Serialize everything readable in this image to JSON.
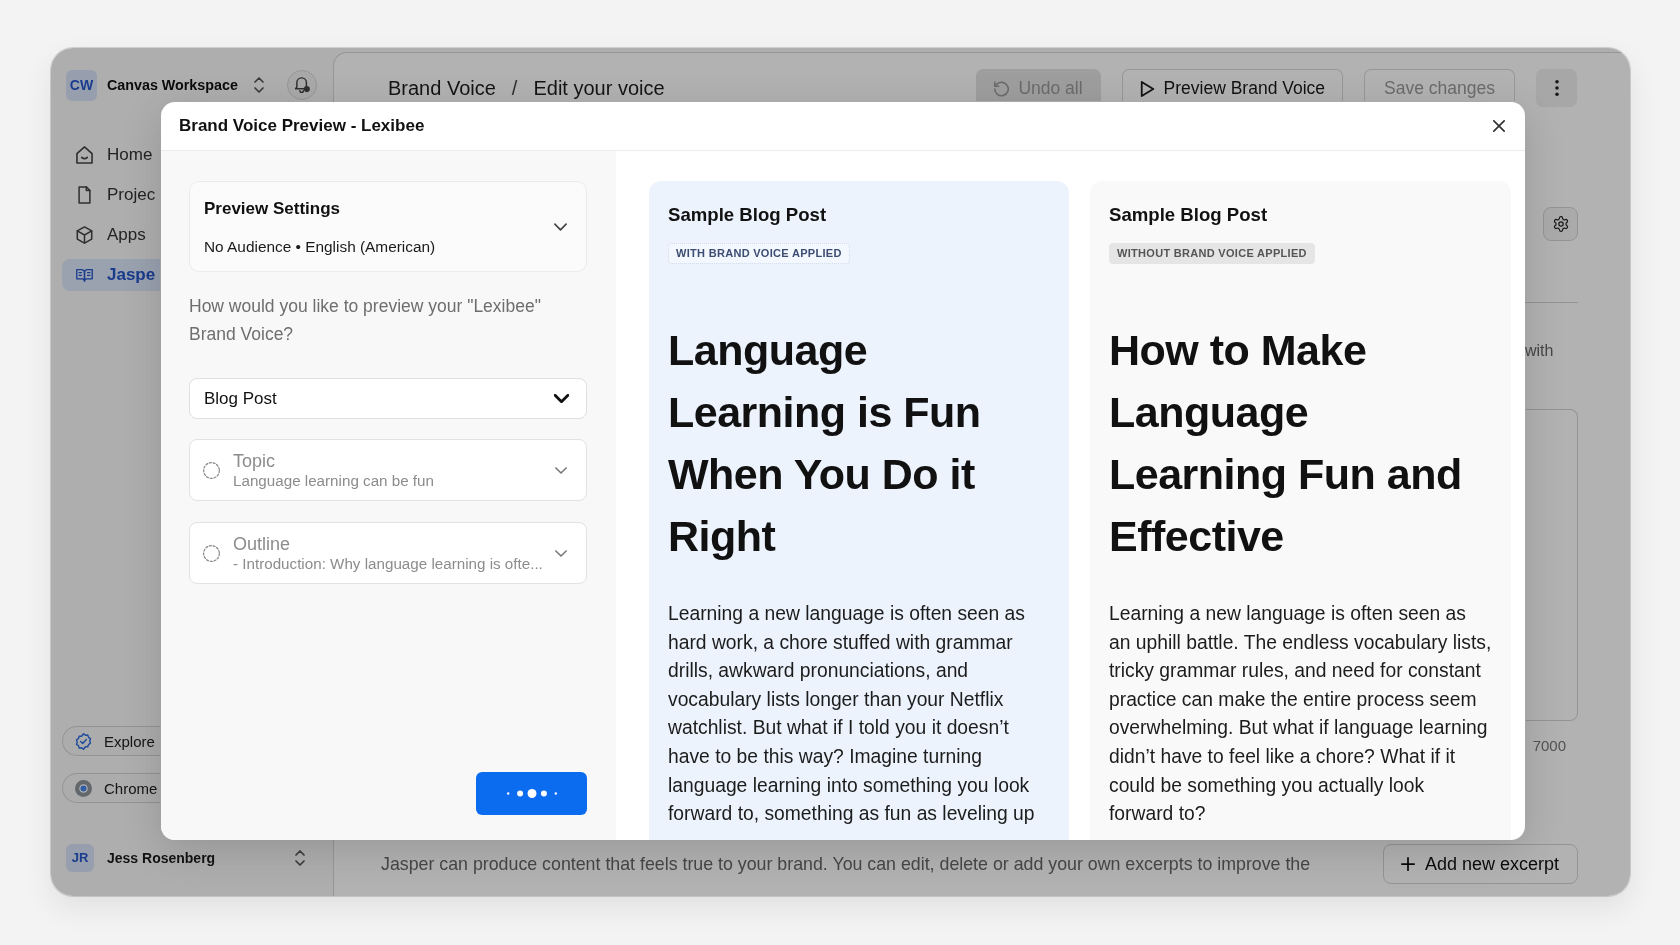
{
  "sidebar": {
    "workspace": {
      "initials": "CW",
      "name": "Canvas Workspace"
    },
    "nav": [
      {
        "label": "Home",
        "selected": false
      },
      {
        "label": "Projec",
        "selected": false
      },
      {
        "label": "Apps",
        "selected": false
      },
      {
        "label": "Jaspe",
        "selected": true
      }
    ],
    "shortcuts": [
      {
        "label": "Explore"
      },
      {
        "label": "Chrome"
      }
    ],
    "user": {
      "initials": "JR",
      "name": "Jess Rosenberg"
    }
  },
  "topbar": {
    "breadcrumb": [
      {
        "label": "Brand Voice"
      },
      {
        "label": "Edit your voice"
      }
    ],
    "separator": "/",
    "buttons": [
      {
        "label": "Undo all",
        "kind": "undo",
        "disabled": true
      },
      {
        "label": "Preview Brand Voice",
        "kind": "preview",
        "disabled": false
      },
      {
        "label": "Save changes",
        "kind": "save",
        "disabled": true
      }
    ]
  },
  "editor": {
    "caption_fragment": "with",
    "counter_fragment": "7000"
  },
  "excerpts": {
    "description": "Jasper can produce content that feels true to your brand. You can edit, delete or add your own excerpts to improve the",
    "add_button": "Add new excerpt"
  },
  "modal": {
    "title": "Brand Voice Preview - Lexibee",
    "settings": {
      "title": "Preview Settings",
      "summary": "No Audience • English (American)",
      "expanded": false
    },
    "question": "How would you like to preview your \"Lexibee\" Brand Voice?",
    "content_type": {
      "value": "Blog Post"
    },
    "inputs": [
      {
        "label": "Topic",
        "value": "Language learning can be fun",
        "disabled": true
      },
      {
        "label": "Outline",
        "value": "- Introduction: Why language learning is ofte...",
        "disabled": true
      }
    ],
    "generate_button": {
      "loading": true
    },
    "previews": [
      {
        "title": "Sample Blog Post",
        "badge": "WITH BRAND VOICE APPLIED",
        "brand_voice_applied": true,
        "heading": "Language Learning is Fun When You Do it Right",
        "body": "Learning a new language is often seen as hard work, a chore stuffed with grammar drills, awkward pronunciations, and vocabulary lists longer than your Netflix watchlist. But what if I told you it doesn’t have to be this way? Imagine turning language learning into something you look forward to, something as fun as leveling up"
      },
      {
        "title": "Sample Blog Post",
        "badge": "WITHOUT BRAND VOICE APPLIED",
        "brand_voice_applied": false,
        "heading": "How to Make Language Learning Fun and Effective",
        "body": "Learning a new language is often seen as an uphill battle. The endless vocabulary lists, tricky grammar rules, and need for constant practice can make the entire process seem overwhelming. But what if language learning didn’t have to feel like a chore? What if it could be something you actually look forward to?"
      }
    ]
  }
}
